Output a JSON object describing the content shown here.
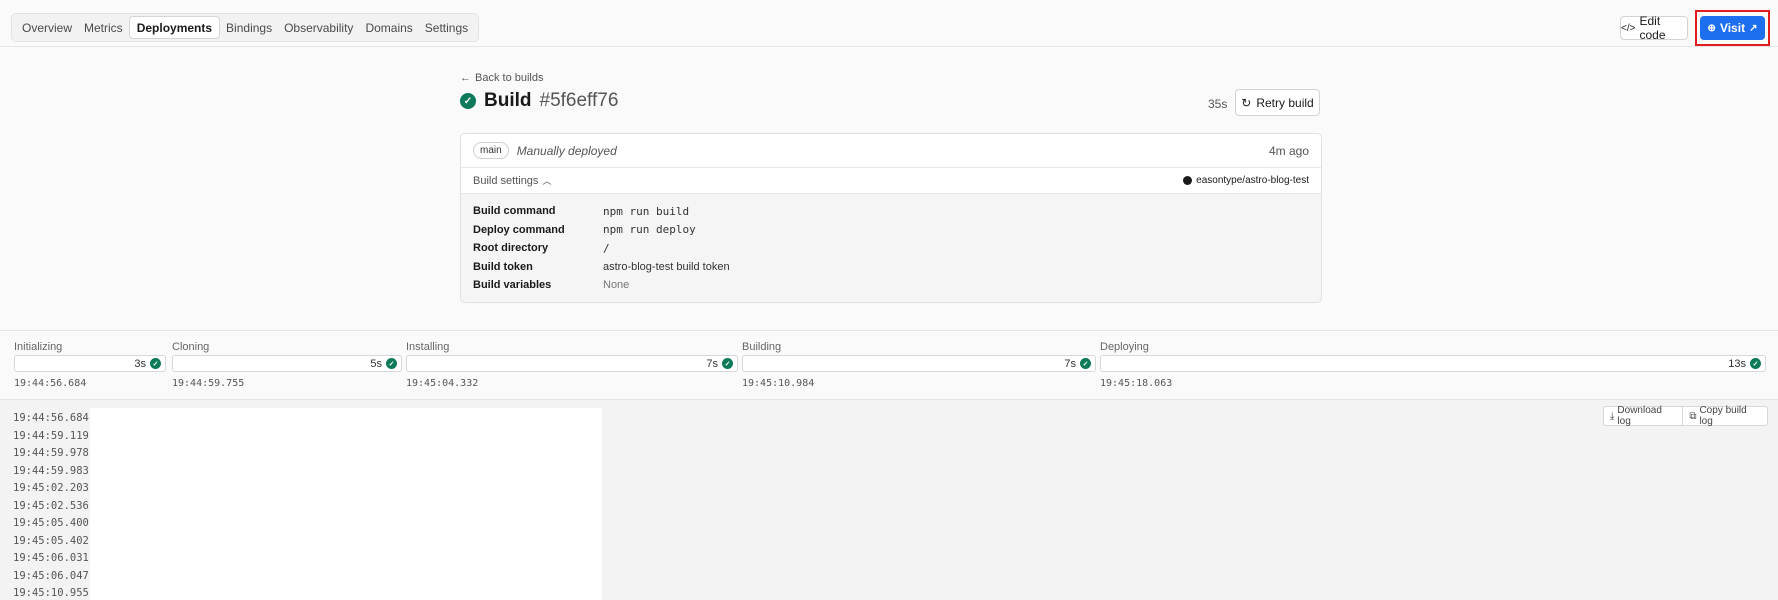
{
  "nav": {
    "tabs": [
      {
        "label": "Overview"
      },
      {
        "label": "Metrics"
      },
      {
        "label": "Deployments"
      },
      {
        "label": "Bindings"
      },
      {
        "label": "Observability"
      },
      {
        "label": "Domains"
      },
      {
        "label": "Settings"
      }
    ],
    "active_tab": "Deployments",
    "edit_code_label": "Edit code",
    "visit_label": "Visit"
  },
  "build": {
    "back_label": "Back to builds",
    "title_label": "Build",
    "hash": "#5f6eff76",
    "duration": "35s",
    "retry_label": "Retry build",
    "branch": "main",
    "deploy_mode": "Manually deployed",
    "time_ago": "4m ago",
    "settings_toggle_label": "Build settings",
    "repo": "easontype/astro-blog-test",
    "settings": [
      {
        "key": "Build command",
        "value": "npm run build",
        "mono": true
      },
      {
        "key": "Deploy command",
        "value": "npm run deploy",
        "mono": true
      },
      {
        "key": "Root directory",
        "value": "/",
        "mono": true
      },
      {
        "key": "Build token",
        "value": "astro-blog-test build token",
        "mono": false
      },
      {
        "key": "Build variables",
        "value": "None",
        "mono": false
      }
    ]
  },
  "stages": [
    {
      "name": "Initializing",
      "duration": "3s",
      "time": "19:44:56.684"
    },
    {
      "name": "Cloning",
      "duration": "5s",
      "time": "19:44:59.755"
    },
    {
      "name": "Installing",
      "duration": "7s",
      "time": "19:45:04.332"
    },
    {
      "name": "Building",
      "duration": "7s",
      "time": "19:45:10.984"
    },
    {
      "name": "Deploying",
      "duration": "13s",
      "time": "19:45:18.063"
    }
  ],
  "log": {
    "download_label": "Download log",
    "copy_label": "Copy build log",
    "timestamps": [
      "19:44:56.684",
      "19:44:59.119",
      "19:44:59.978",
      "19:44:59.983",
      "19:45:02.203",
      "19:45:02.536",
      "19:45:05.400",
      "19:45:05.402",
      "19:45:06.031",
      "19:45:06.047",
      "19:45:10.955"
    ]
  }
}
